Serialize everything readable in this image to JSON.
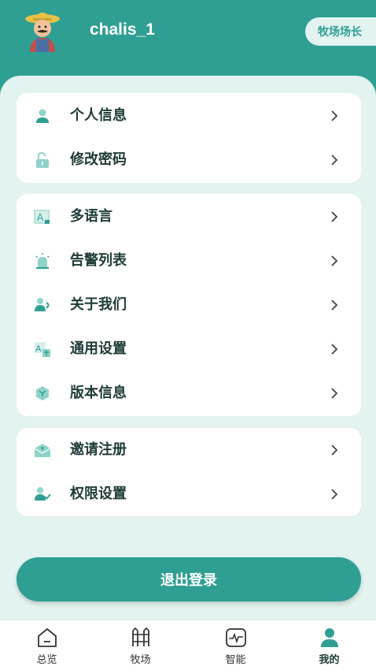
{
  "profile": {
    "username": "chalis_1",
    "role": "牧场场长"
  },
  "menu_groups": [
    {
      "items": [
        {
          "icon": "person-icon",
          "label": "个人信息"
        },
        {
          "icon": "unlock-icon",
          "label": "修改密码"
        }
      ]
    },
    {
      "items": [
        {
          "icon": "language-icon",
          "label": "多语言"
        },
        {
          "icon": "alarm-icon",
          "label": "告警列表"
        },
        {
          "icon": "about-icon",
          "label": "关于我们"
        },
        {
          "icon": "settings-translate-icon",
          "label": "通用设置"
        },
        {
          "icon": "version-icon",
          "label": "版本信息"
        }
      ]
    },
    {
      "items": [
        {
          "icon": "invite-mail-icon",
          "label": "邀请注册"
        },
        {
          "icon": "permission-icon",
          "label": "权限设置"
        }
      ]
    }
  ],
  "logout_label": "退出登录",
  "tabbar": [
    {
      "icon": "home-icon",
      "label": "总览"
    },
    {
      "icon": "ranch-icon",
      "label": "牧场"
    },
    {
      "icon": "pulse-icon",
      "label": "智能"
    },
    {
      "icon": "user-icon",
      "label": "我的",
      "active": true
    }
  ],
  "colors": {
    "accent": "#2f9f93",
    "panel": "#e3f3f0",
    "icon_light": "#8fd3c9"
  }
}
